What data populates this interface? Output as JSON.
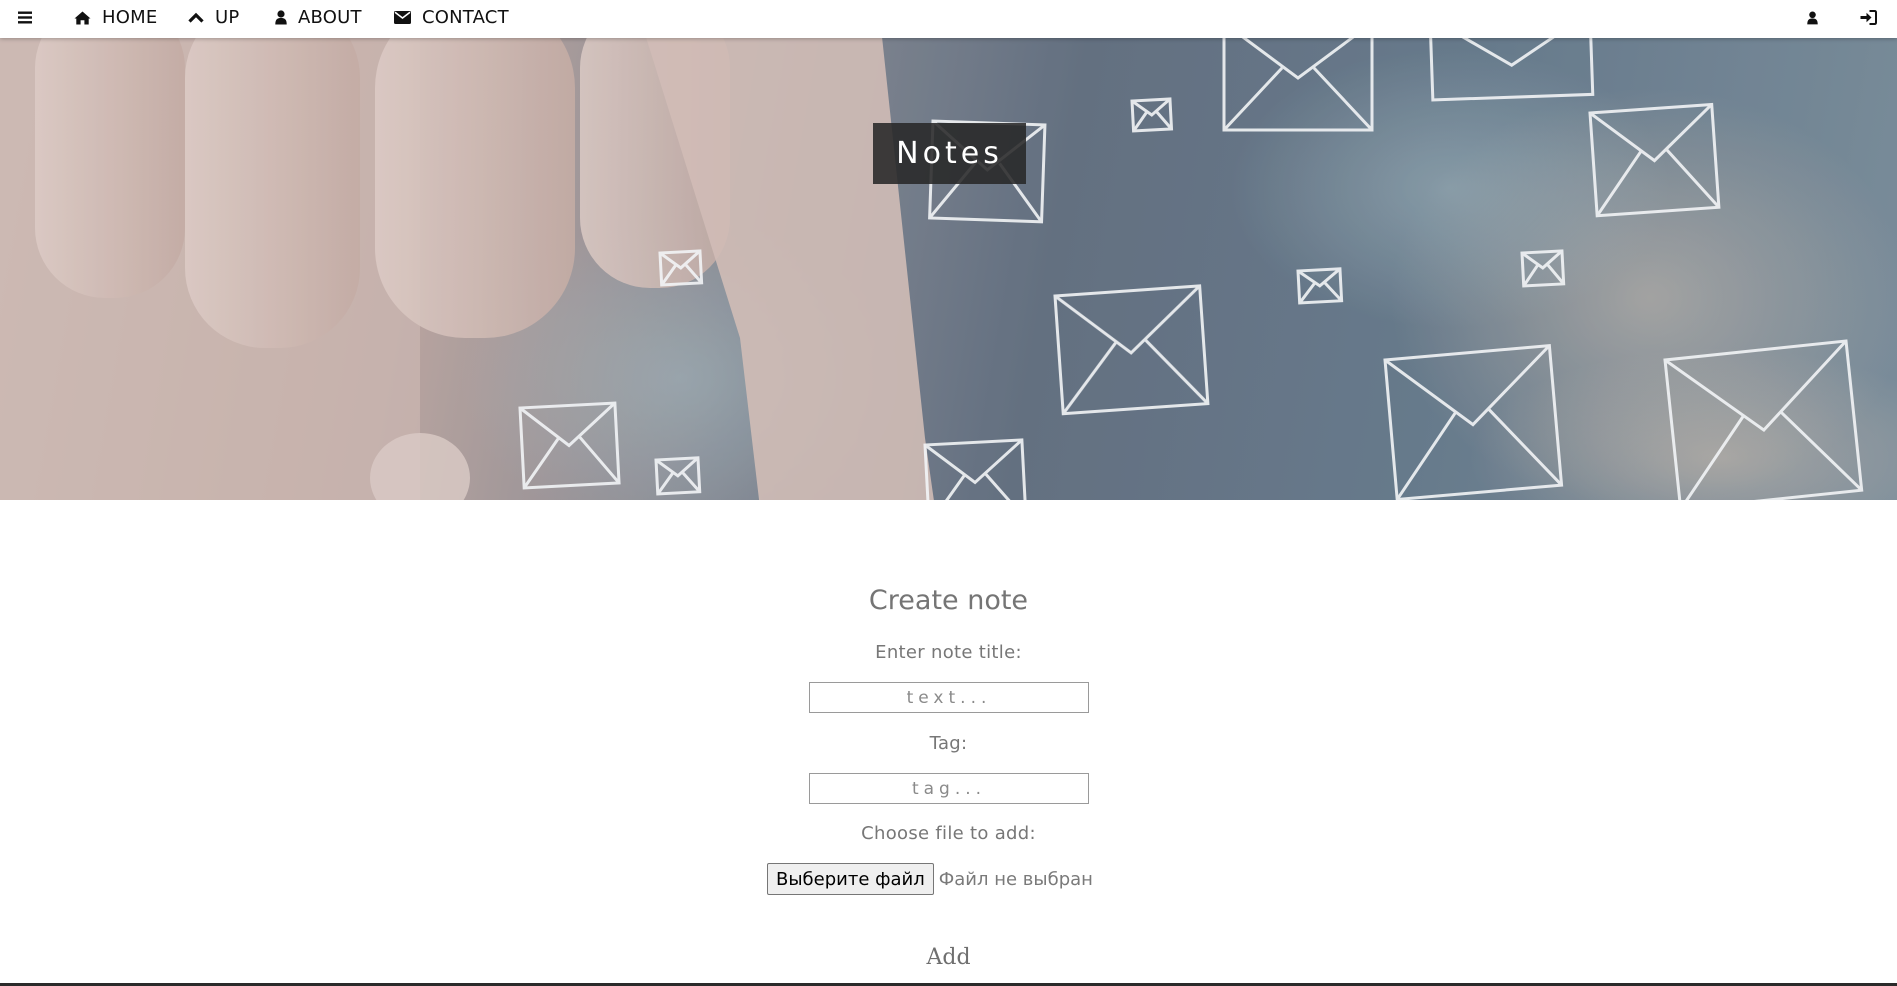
{
  "nav": {
    "menu_icon": "bars-icon",
    "items": [
      {
        "label": "HOME",
        "icon": "home-icon"
      },
      {
        "label": "UP",
        "icon": "chevron-up-icon"
      },
      {
        "label": "ABOUT",
        "icon": "user-icon"
      },
      {
        "label": "CONTACT",
        "icon": "envelope-icon"
      }
    ],
    "right_icons": [
      "user-icon",
      "sign-in-icon"
    ]
  },
  "hero": {
    "title": "Notes"
  },
  "form": {
    "heading": "Create note",
    "title_label": "Enter note title:",
    "title_placeholder": "text...",
    "tag_label": "Tag:",
    "tag_placeholder": "tag...",
    "file_label": "Choose file to add:",
    "file_button": "Выберите файл",
    "file_status": "Файл не выбран",
    "submit": "Add"
  },
  "colors": {
    "nav_text": "#111111",
    "title_box": "#2f2f2f",
    "form_text": "#777777"
  }
}
